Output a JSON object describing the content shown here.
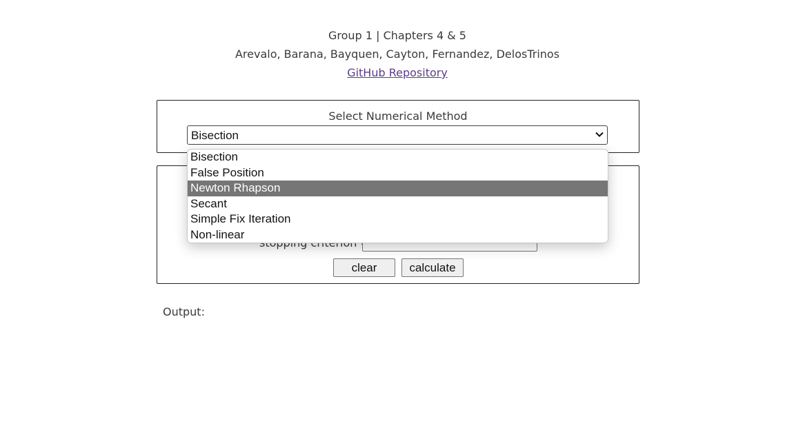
{
  "header": {
    "group": "Group 1",
    "separator": "|",
    "chapters": "Chapters 4 & 5",
    "authors": "Arevalo, Barana, Bayquen, Cayton, Fernandez, DelosTrinos",
    "repo_link": "GitHub Repository"
  },
  "method_panel": {
    "label": "Select Numerical Method",
    "selected": "Bisection"
  },
  "dropdown": {
    "highlighted_index": 2,
    "options": [
      "Bisection",
      "False Position",
      "Newton Rhapson",
      "Secant",
      "Simple Fix Iteration",
      "Non-linear"
    ]
  },
  "inputs_panel": {
    "criterion_label": "stopping criterion =",
    "criterion_value": "",
    "clear_label": "clear",
    "calculate_label": "calculate"
  },
  "output": {
    "label": "Output:"
  },
  "colors": {
    "highlight": "#767676",
    "link": "#5a3d8a",
    "border": "#222222"
  }
}
